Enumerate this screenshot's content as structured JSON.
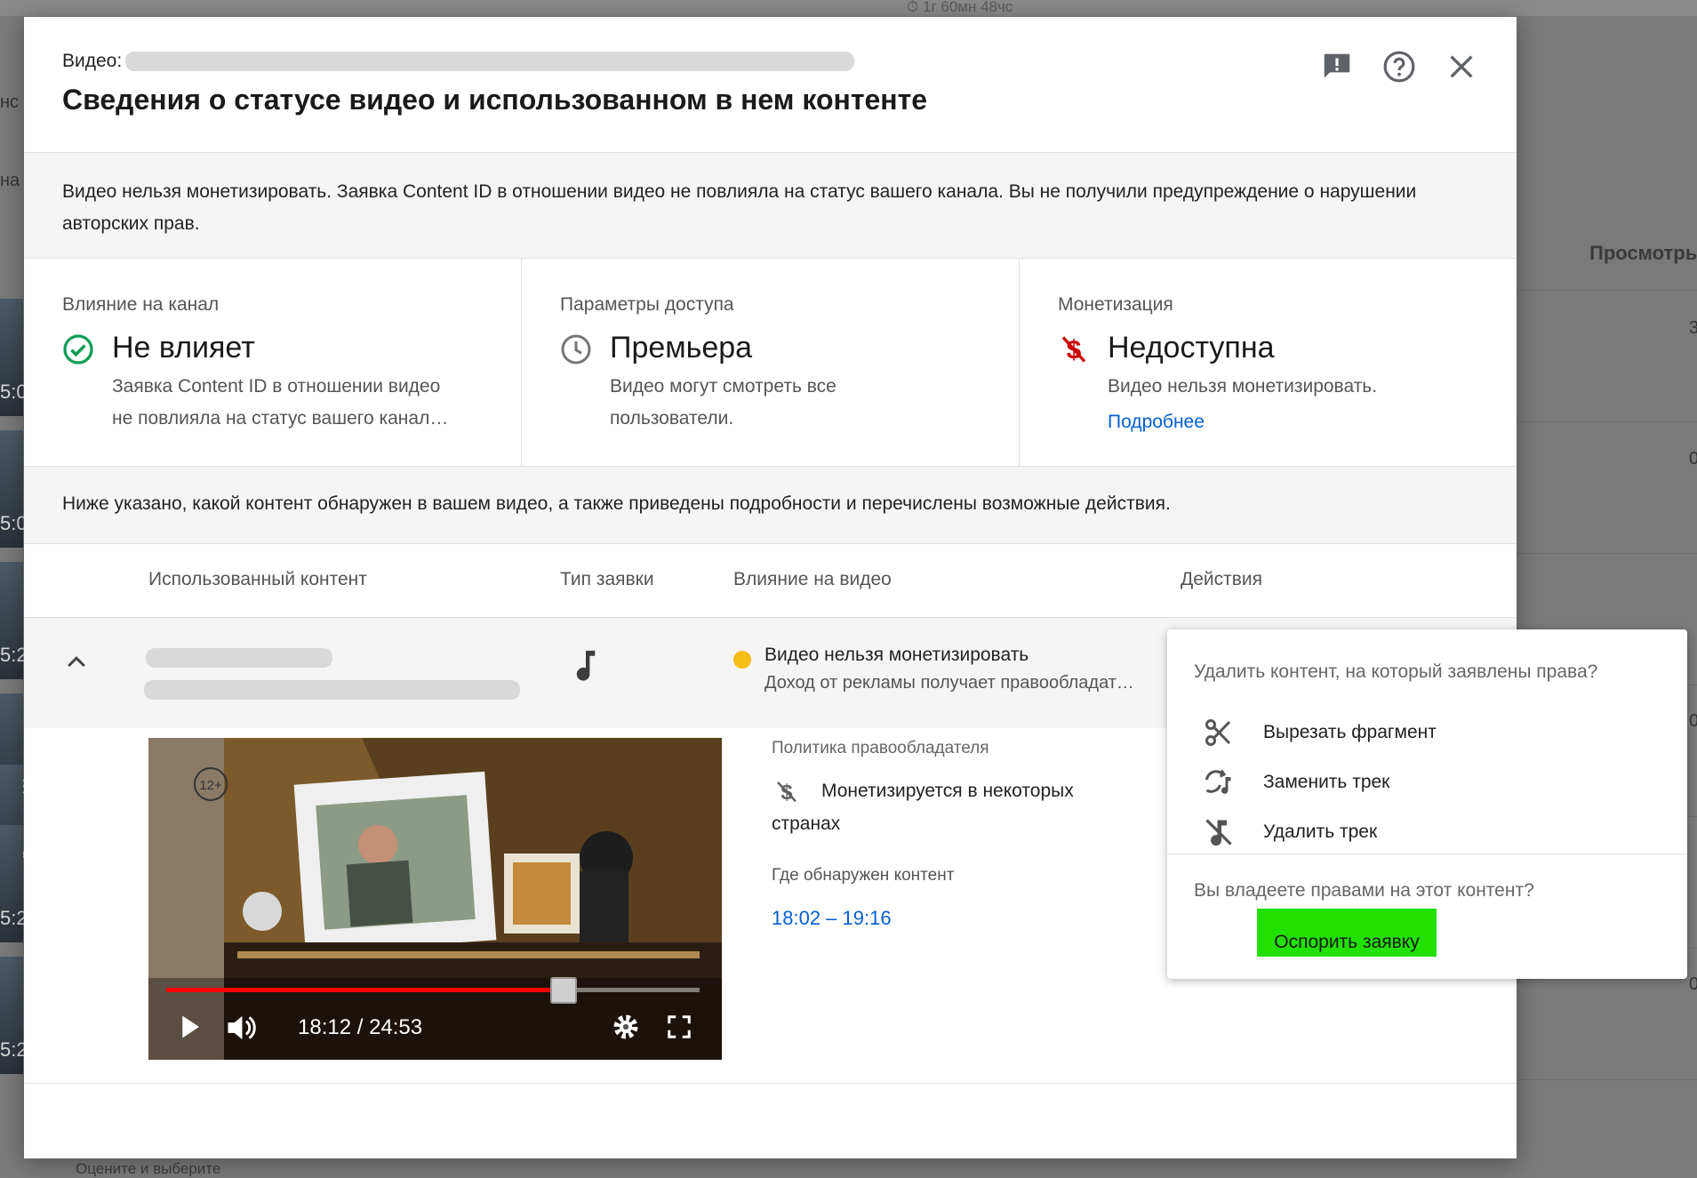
{
  "background": {
    "top_stats": "⏱ 1г 60мн 48чс",
    "views_header": "Просмотры",
    "left_fragments": [
      "нс",
      "на"
    ],
    "thumb_badges": [
      "5:0",
      "5:0",
      "5:2",
      "5:2",
      "ЕР",
      "5:2",
      "5:2"
    ],
    "right_numbers": [
      "3",
      "0",
      "0",
      "0"
    ],
    "bottom_text": "Оцените и выберите"
  },
  "header": {
    "video_label": "Видео:",
    "title": "Сведения о статусе видео и использованном в нем контенте",
    "icons": [
      "feedback-icon",
      "help-icon",
      "close-icon"
    ]
  },
  "summary": {
    "text": "Видео нельзя монетизировать. Заявка Content ID в отношении видео не повлияла на статус вашего канала. Вы не получили предупреждение о нарушении авторских прав."
  },
  "cards": {
    "channel": {
      "label": "Влияние на канал",
      "value": "Не влияет",
      "desc": "Заявка Content ID в отношении видео не повлияла на статус вашего канала…",
      "icon": "check-circle-icon",
      "color": "#0f9d58"
    },
    "access": {
      "label": "Параметры доступа",
      "value": "Премьера",
      "desc": "Видео могут смотреть все пользователи.",
      "icon": "clock-icon"
    },
    "monetization": {
      "label": "Монетизация",
      "value": "Недоступна",
      "desc": "Видео нельзя монетизировать.",
      "link": "Подробнее",
      "icon": "no-money-icon",
      "color": "#cc0000"
    }
  },
  "content_intro": "Ниже указано, какой контент обнаружен в вашем видео, а также приведены подробности и перечислены возможные действия.",
  "table": {
    "headers": {
      "content": "Использованный контент",
      "claim_type": "Тип заявки",
      "impact": "Влияние на видео",
      "actions": "Действия"
    },
    "row": {
      "claim_type_icon": "music-note-icon",
      "impact_title": "Видео нельзя монетизировать",
      "impact_sub": "Доход от рекламы получает правообладатель",
      "impact_dot_color": "#f6bd16",
      "policy_label": "Политика правообладателя",
      "policy_text": "Монетизируется в некоторых странах",
      "where_label": "Где обнаружен контент",
      "where_range": "18:02 – 19:16",
      "player": {
        "time": "18:12 / 24:53",
        "age_badge": "12+",
        "progress": 0.745
      }
    }
  },
  "actions_popup": {
    "question1": "Удалить контент, на который заявлены права?",
    "items": [
      {
        "label": "Вырезать фрагмент",
        "icon": "scissors-icon"
      },
      {
        "label": "Заменить трек",
        "icon": "swap-music-icon"
      },
      {
        "label": "Удалить трек",
        "icon": "music-off-icon"
      }
    ],
    "question2": "Вы владеете правами на этот контент?",
    "dispute_button": "Оспорить заявку",
    "dispute_color": "#22e000"
  }
}
